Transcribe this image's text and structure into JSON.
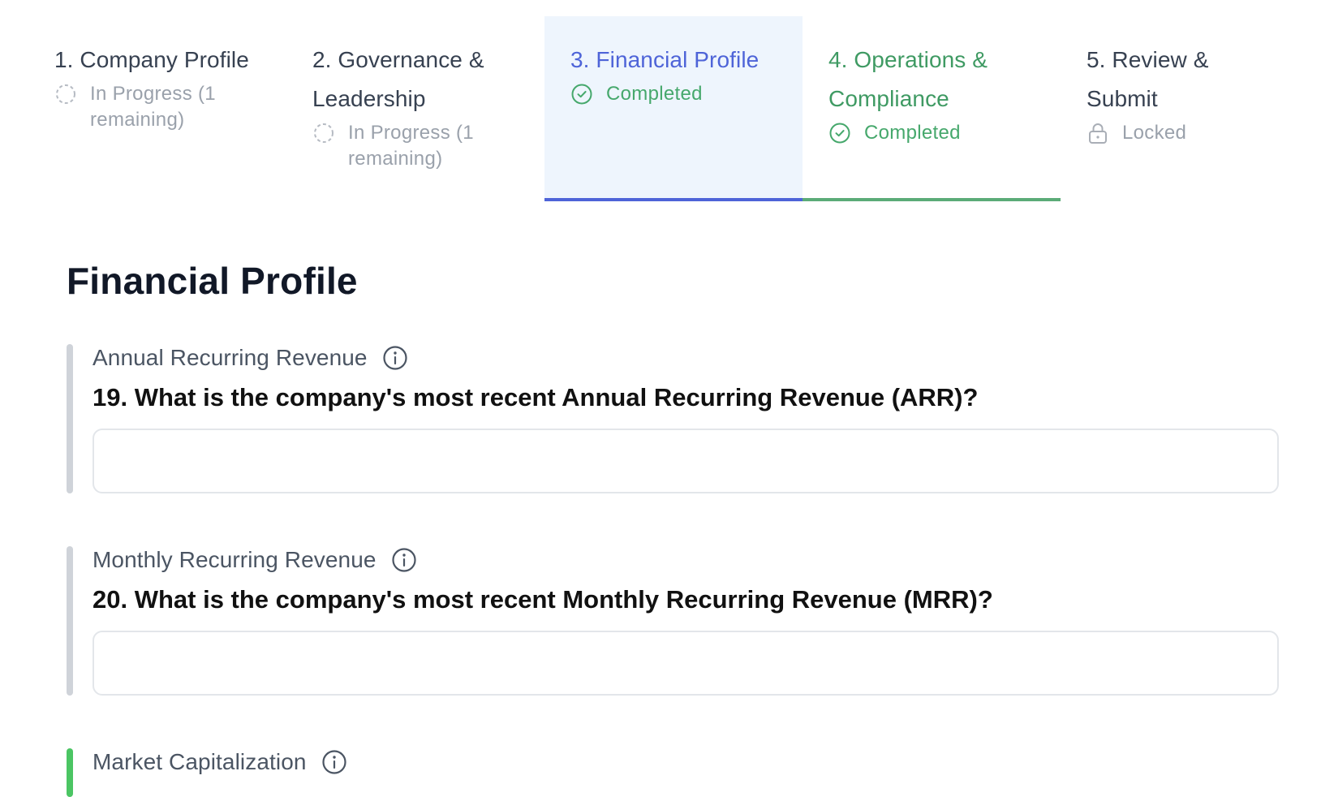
{
  "stepper": {
    "steps": [
      {
        "title": "1. Company Profile",
        "status": "In Progress (1 remaining)",
        "state": "in-progress"
      },
      {
        "title": "2. Governance & Leadership",
        "status": "In Progress (1 remaining)",
        "state": "in-progress"
      },
      {
        "title": "3. Financial Profile",
        "status": "Completed",
        "state": "active-completed"
      },
      {
        "title": "4. Operations & Compliance",
        "status": "Completed",
        "state": "completed"
      },
      {
        "title": "5. Review & Submit",
        "status": "Locked",
        "state": "locked"
      }
    ]
  },
  "section": {
    "title": "Financial Profile"
  },
  "questions": [
    {
      "label": "Annual Recurring Revenue",
      "text": "19. What is the company's most recent Annual Recurring Revenue (ARR)?",
      "value": "",
      "answered": false
    },
    {
      "label": "Monthly Recurring Revenue",
      "text": "20. What is the company's most recent Monthly Recurring Revenue (MRR)?",
      "value": "",
      "answered": false
    },
    {
      "label": "Market Capitalization",
      "answered": true
    }
  ],
  "colors": {
    "active": "#4e64d8",
    "completed": "#3f9a63",
    "muted": "#9aa1ab",
    "answered_bar": "#4bc563",
    "unanswered_bar": "#cfd3d9"
  }
}
